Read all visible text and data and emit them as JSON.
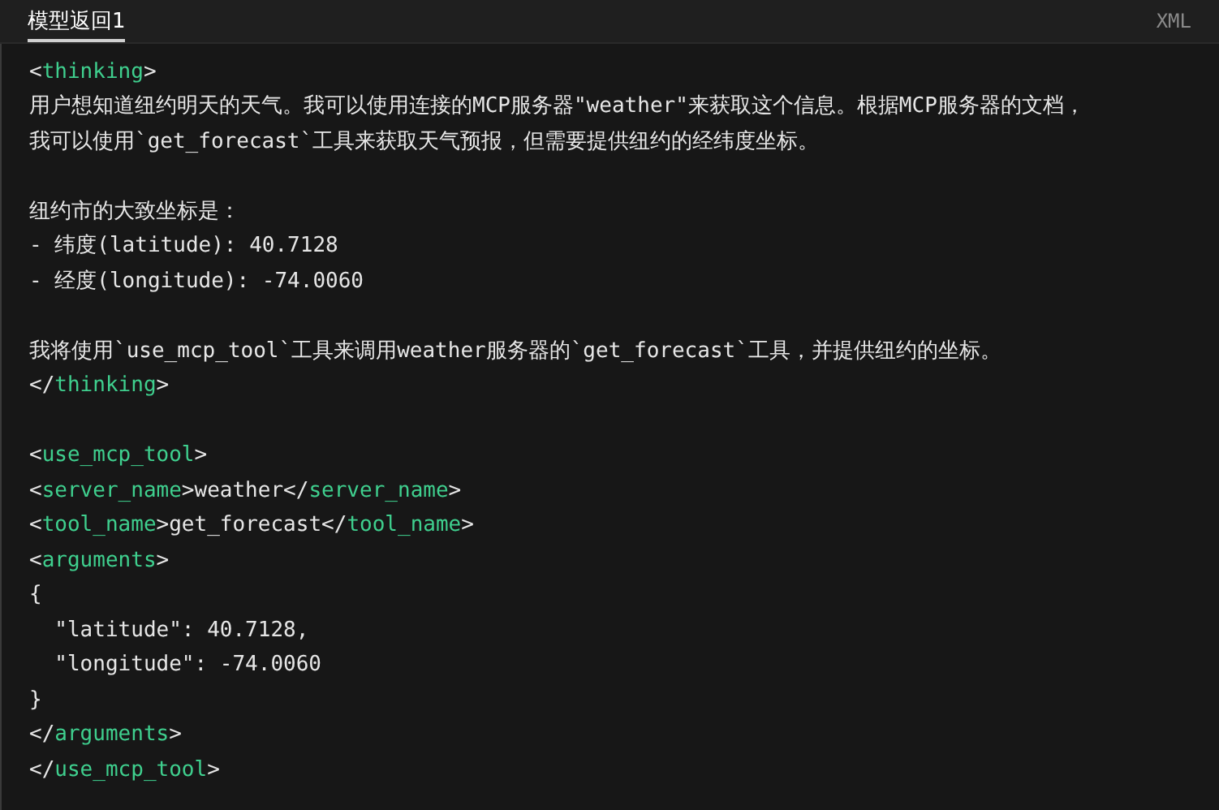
{
  "tabs": [
    {
      "label": "模型返回1",
      "selected": true
    }
  ],
  "language": "XML",
  "code_blocks": [
    [
      [
        {
          "kind": "plain",
          "text": "<"
        },
        {
          "kind": "tag",
          "text": "thinking"
        },
        {
          "kind": "plain",
          "text": ">"
        }
      ],
      [
        {
          "kind": "plain",
          "text": "用户想知道纽约明天的天气。我可以使用连接的MCP服务器\"weather\"来获取这个信息。根据MCP服务器的文档，"
        }
      ],
      [
        {
          "kind": "plain",
          "text": "我可以使用`get_forecast`工具来获取天气预报，但需要提供纽约的经纬度坐标。"
        }
      ]
    ],
    [
      [
        {
          "kind": "plain",
          "text": "纽约市的大致坐标是："
        }
      ],
      [
        {
          "kind": "plain",
          "text": "- 纬度(latitude): 40.7128"
        }
      ],
      [
        {
          "kind": "plain",
          "text": "- 经度(longitude): -74.0060"
        }
      ]
    ],
    [
      [
        {
          "kind": "plain",
          "text": "我将使用`use_mcp_tool`工具来调用weather服务器的`get_forecast`工具，并提供纽约的坐标。"
        }
      ],
      [
        {
          "kind": "plain",
          "text": "</"
        },
        {
          "kind": "tag",
          "text": "thinking"
        },
        {
          "kind": "plain",
          "text": ">"
        }
      ]
    ],
    [
      [
        {
          "kind": "plain",
          "text": "<"
        },
        {
          "kind": "tag",
          "text": "use_mcp_tool"
        },
        {
          "kind": "plain",
          "text": ">"
        }
      ],
      [
        {
          "kind": "plain",
          "text": "<"
        },
        {
          "kind": "tag",
          "text": "server_name"
        },
        {
          "kind": "plain",
          "text": ">weather</"
        },
        {
          "kind": "tag",
          "text": "server_name"
        },
        {
          "kind": "plain",
          "text": ">"
        }
      ],
      [
        {
          "kind": "plain",
          "text": "<"
        },
        {
          "kind": "tag",
          "text": "tool_name"
        },
        {
          "kind": "plain",
          "text": ">get_forecast</"
        },
        {
          "kind": "tag",
          "text": "tool_name"
        },
        {
          "kind": "plain",
          "text": ">"
        }
      ],
      [
        {
          "kind": "plain",
          "text": "<"
        },
        {
          "kind": "tag",
          "text": "arguments"
        },
        {
          "kind": "plain",
          "text": ">"
        }
      ],
      [
        {
          "kind": "plain",
          "text": "{"
        }
      ],
      [
        {
          "kind": "plain",
          "text": "  \"latitude\": 40.7128,"
        }
      ],
      [
        {
          "kind": "plain",
          "text": "  \"longitude\": -74.0060"
        }
      ],
      [
        {
          "kind": "plain",
          "text": "}"
        }
      ],
      [
        {
          "kind": "plain",
          "text": "</"
        },
        {
          "kind": "tag",
          "text": "arguments"
        },
        {
          "kind": "plain",
          "text": ">"
        }
      ],
      [
        {
          "kind": "plain",
          "text": "</"
        },
        {
          "kind": "tag",
          "text": "use_mcp_tool"
        },
        {
          "kind": "plain",
          "text": ">"
        }
      ]
    ]
  ]
}
